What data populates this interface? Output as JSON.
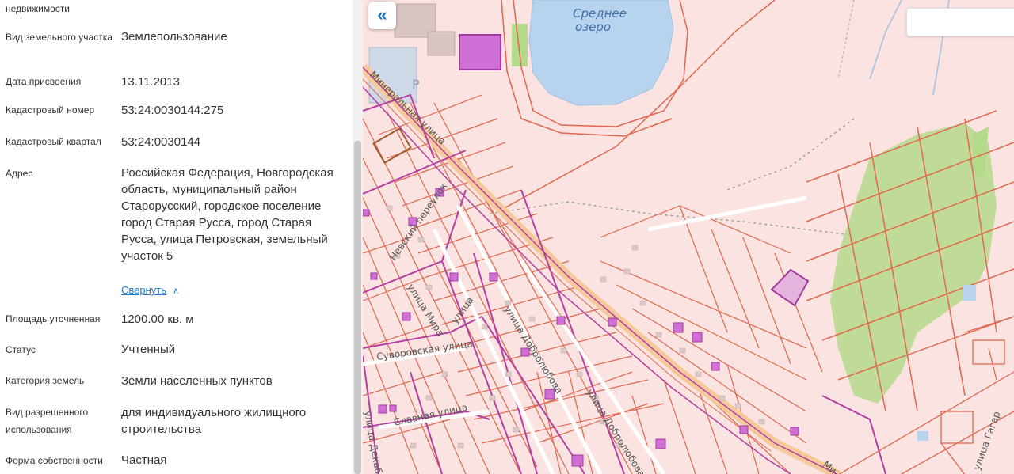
{
  "info": {
    "top_fragment": "недвижимости",
    "rows": [
      {
        "label": "Вид земельного участка",
        "value": "Землепользование"
      },
      {
        "label": "Дата присвоения",
        "value": "13.11.2013"
      },
      {
        "label": "Кадастровый номер",
        "value": "53:24:0030144:275"
      },
      {
        "label": "Кадастровый квартал",
        "value": "53:24:0030144"
      },
      {
        "label": "Адрес",
        "value": "Российская Федерация, Новгородская область, муниципальный район Старорусский, городское поселение город Старая Русса, город Старая Русса, улица Петровская, земельный участок 5"
      },
      {
        "label": "Площадь уточненная",
        "value": "1200.00 кв. м"
      },
      {
        "label": "Статус",
        "value": "Учтенный"
      },
      {
        "label": "Категория земель",
        "value": "Земли населенных пунктов"
      },
      {
        "label": "Вид разрешенного использования",
        "value": "для индивидуального жилищного строительства"
      },
      {
        "label": "Форма собственности",
        "value": "Частная"
      }
    ],
    "collapse_link": "Свернуть"
  },
  "map": {
    "collapse_button_icon": "double-chevron-left-icon",
    "collapse_button_glyph": "«",
    "labels": {
      "lake_line1": "Среднее",
      "lake_line2": "озеро",
      "street_mineralnaya": "Минеральная улица",
      "street_nevsky": "Невский переулок",
      "street_mira": "улица Мира",
      "street_suvorovskaya": "Суворовская улица",
      "street_slavnaya": "Славная улица",
      "street_dobrolyubova": "улица Добролюбова",
      "street_dobrolyubova2": "улица Добролюбова",
      "street_gagarina": "улица Гагар",
      "street_partial_ul": "улица",
      "street_partial_dek": "улица Декаб",
      "street_partial_mi": "Ми"
    },
    "colors": {
      "background": "#fae3e1",
      "parcel_border": "#e0674e",
      "quarter_border": "#b33fa0",
      "building_fill": "#cf6fd6",
      "road": "#f6c99a",
      "water": "#b7d3ee",
      "greenery": "#b5d98a",
      "selected_parcel": "#a13b9c"
    }
  }
}
